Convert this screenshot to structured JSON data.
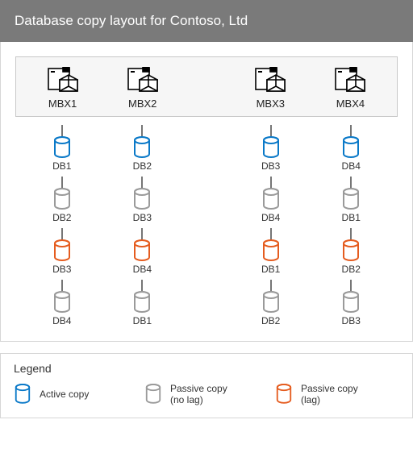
{
  "title": "Database copy layout for Contoso, Ltd",
  "colors": {
    "active": "#0a79c8",
    "passive_nolag": "#9a9a9a",
    "passive_lag": "#e55c1f"
  },
  "servers": [
    "MBX1",
    "MBX2",
    "MBX3",
    "MBX4"
  ],
  "columns": [
    [
      {
        "label": "DB1",
        "state": "active"
      },
      {
        "label": "DB2",
        "state": "passive_nolag"
      },
      {
        "label": "DB3",
        "state": "passive_lag"
      },
      {
        "label": "DB4",
        "state": "passive_nolag"
      }
    ],
    [
      {
        "label": "DB2",
        "state": "active"
      },
      {
        "label": "DB3",
        "state": "passive_nolag"
      },
      {
        "label": "DB4",
        "state": "passive_lag"
      },
      {
        "label": "DB1",
        "state": "passive_nolag"
      }
    ],
    [
      {
        "label": "DB3",
        "state": "active"
      },
      {
        "label": "DB4",
        "state": "passive_nolag"
      },
      {
        "label": "DB1",
        "state": "passive_lag"
      },
      {
        "label": "DB2",
        "state": "passive_nolag"
      }
    ],
    [
      {
        "label": "DB4",
        "state": "active"
      },
      {
        "label": "DB1",
        "state": "passive_nolag"
      },
      {
        "label": "DB2",
        "state": "passive_lag"
      },
      {
        "label": "DB3",
        "state": "passive_nolag"
      }
    ]
  ],
  "legend": {
    "title": "Legend",
    "items": [
      {
        "state": "active",
        "text": "Active copy"
      },
      {
        "state": "passive_nolag",
        "text": "Passive copy\n(no lag)"
      },
      {
        "state": "passive_lag",
        "text": "Passive copy\n(lag)"
      }
    ]
  }
}
